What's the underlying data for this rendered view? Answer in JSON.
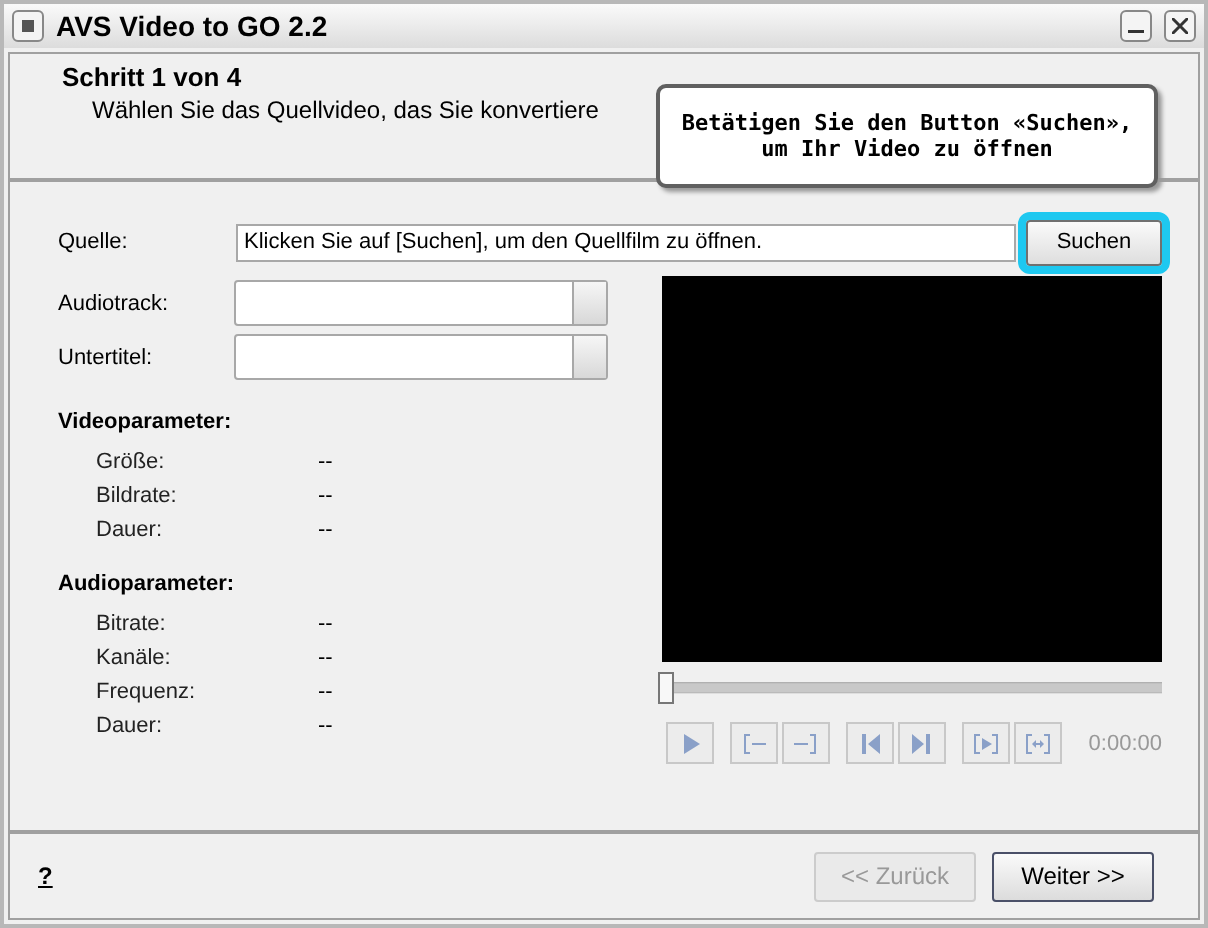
{
  "window": {
    "title": "AVS Video to GO 2.2"
  },
  "header": {
    "step": "Schritt 1 von 4",
    "description": "Wählen Sie das Quellvideo, das Sie konvertiere"
  },
  "tooltip": {
    "text": "Betätigen Sie den Button «Suchen»,\num Ihr Video zu öffnen"
  },
  "source": {
    "label": "Quelle:",
    "value": "Klicken Sie auf [Suchen], um den Quellfilm zu öffnen.",
    "button": "Suchen",
    "highlighted": true
  },
  "dropdowns": [
    {
      "label": "Audiotrack:"
    },
    {
      "label": "Untertitel:"
    }
  ],
  "sections": [
    {
      "title": "Videoparameter:",
      "rows": [
        {
          "label": "Größe:",
          "value": "--"
        },
        {
          "label": "Bildrate:",
          "value": "--"
        },
        {
          "label": "Dauer:",
          "value": "--"
        }
      ]
    },
    {
      "title": "Audioparameter:",
      "rows": [
        {
          "label": "Bitrate:",
          "value": "--"
        },
        {
          "label": "Kanäle:",
          "value": "--"
        },
        {
          "label": "Frequenz:",
          "value": "--"
        },
        {
          "label": "Dauer:",
          "value": "--"
        }
      ]
    }
  ],
  "player": {
    "level": 0,
    "time": "0:00:00",
    "controls_disabled": true
  },
  "footer": {
    "help": "?",
    "buttons": [
      {
        "label": "<< Zurück",
        "disabled": true
      },
      {
        "label": "Weiter >>",
        "disabled": false
      }
    ]
  }
}
